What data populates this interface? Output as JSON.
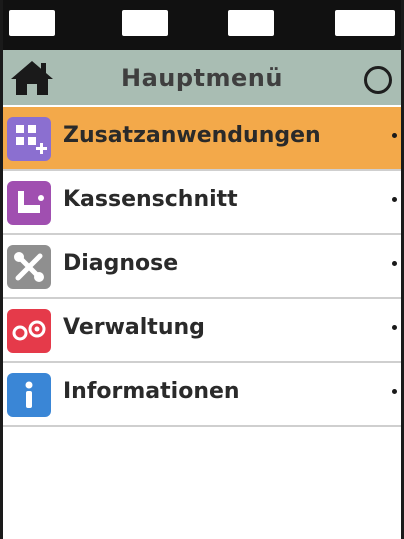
{
  "header": {
    "title": "Hauptmenü",
    "home_icon": "home-icon",
    "circle_icon": "circle-icon"
  },
  "menu": {
    "items": [
      {
        "label": "Zusatzanwendungen",
        "icon": "apps-add-icon",
        "color": "#8b6fd0",
        "active": true
      },
      {
        "label": "Kassenschnitt",
        "icon": "receipt-cut-icon",
        "color": "#a04fb0",
        "active": false
      },
      {
        "label": "Diagnose",
        "icon": "tools-icon",
        "color": "#8f8f8f",
        "active": false
      },
      {
        "label": "Verwaltung",
        "icon": "settings-admin-icon",
        "color": "#e53a4a",
        "active": false
      },
      {
        "label": "Informationen",
        "icon": "info-icon",
        "color": "#3a86d6",
        "active": false
      }
    ]
  },
  "colors": {
    "header_bg": "#a9bdb3",
    "active_bg": "#f3a94a",
    "top_bar": "#111111"
  }
}
